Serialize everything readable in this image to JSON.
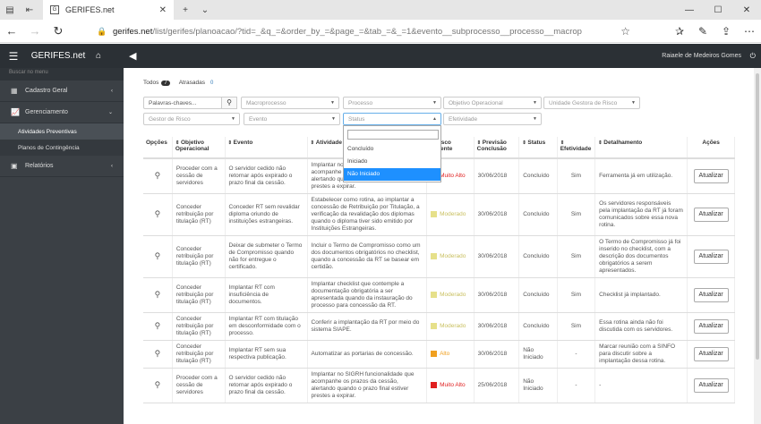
{
  "browser": {
    "tab_title": "GERIFES.net",
    "url_host": "gerifes.net",
    "url_path": "/list/gerifes/planoacao/?tid=_&q_=&order_by_=&page_=&tab_=&_=1&evento__subprocesso__processo__macrop"
  },
  "app": {
    "brand": "GERIFES.net",
    "user": "Raiaele de Medeiros Gomes"
  },
  "sidebar": {
    "search_placeholder": "Buscar no menu",
    "items": [
      {
        "label": "Cadastro Geral",
        "icon": "table-icon"
      },
      {
        "label": "Gerenciamento",
        "icon": "chart-icon"
      },
      {
        "label": "Relatórios",
        "icon": "report-icon"
      }
    ],
    "subitems": [
      "Atividades Preventivas",
      "Planos de Contingência"
    ]
  },
  "tabs": {
    "todos": "Todos",
    "todos_count": "7",
    "atrasadas": "Atrasadas",
    "atrasadas_count": "0"
  },
  "filters": {
    "keywords": "Palavras-chaves...",
    "macroprocesso": "Macroprocesso",
    "processo": "Processo",
    "objetivo": "Objetivo Operacional",
    "unidade": "Unidade Gestora de Risco",
    "gestor": "Gestor de Risco",
    "evento": "Evento",
    "status": "Status",
    "efetividade": "Efetividade"
  },
  "status_dropdown": {
    "options": [
      "Concluído",
      "Iniciado",
      "Não Iniciado"
    ],
    "selected": "Não Iniciado"
  },
  "table": {
    "headers": [
      "Opções",
      "Objetivo Operacional",
      "Evento",
      "Atividade",
      "Risco Inerente",
      "Previsão Conclusão",
      "Status",
      "Efetividade",
      "Detalhamento",
      "Ações"
    ],
    "action_label": "Atualizar",
    "rows": [
      {
        "obj": "Proceder com a cessão de servidores",
        "evento": "O servidor cedido não retornar após expirado o prazo final da cessão.",
        "atividade": "Implantar no SIGRH funcionalidade que acompanhe os prazos da cessão, alertando quando o prazo final estiver prestes a expirar.",
        "risco": "Muito Alto",
        "cor": "#e02020",
        "prev": "30/06/2018",
        "status": "Concluído",
        "efet": "Sim",
        "det": "Ferramenta já em utilização."
      },
      {
        "obj": "Conceder retribuição por titulação (RT)",
        "evento": "Conceder RT sem revalidar diploma oriundo de instituições estrangeiras.",
        "atividade": "Estabelecer como rotina, ao implantar a concessão de Retribuição por Titulação, a verificação da revalidação dos diplomas quando o diploma tiver sido emitido por Instituições Estrangeiras.",
        "risco": "Moderado",
        "cor": "#e6e08a",
        "prev": "30/06/2018",
        "status": "Concluído",
        "efet": "Sim",
        "det": "Os servidores responsáveis pela implantação da RT já foram comunicados sobre essa nova rotina."
      },
      {
        "obj": "Conceder retribuição por titulação (RT)",
        "evento": "Deixar de submeter o Termo de Compromisso quando não for entregue o certificado.",
        "atividade": "Incluir o Termo de Compromisso como um dos documentos obrigatórios no checklist, quando a concessão da RT se basear em certidão.",
        "risco": "Moderado",
        "cor": "#e6e08a",
        "prev": "30/06/2018",
        "status": "Concluído",
        "efet": "Sim",
        "det": "O Termo de Compromisso já foi inserido no checklist, com a descrição dos documentos obrigatórios a serem apresentados."
      },
      {
        "obj": "Conceder retribuição por titulação (RT)",
        "evento": "Implantar RT com insuficiência de documentos.",
        "atividade": "Implantar checklist que contemple a documentação obrigatória a ser apresentada quando da instauração do processo para concessão da RT.",
        "risco": "Moderado",
        "cor": "#e6e08a",
        "prev": "30/06/2018",
        "status": "Concluído",
        "efet": "Sim",
        "det": "Checklist já implantado."
      },
      {
        "obj": "Conceder retribuição por titulação (RT)",
        "evento": "Implantar RT com titulação em desconformidade com o processo.",
        "atividade": "Conferir a implantação da RT por meio do sistema SIAPE.",
        "risco": "Moderado",
        "cor": "#e6e08a",
        "prev": "30/06/2018",
        "status": "Concluído",
        "efet": "Sim",
        "det": "Essa rotina ainda não foi discutida com os servidores."
      },
      {
        "obj": "Conceder retribuição por titulação (RT)",
        "evento": "Implantar RT sem sua respectiva publicação.",
        "atividade": "Automatizar as portarias de concessão.",
        "risco": "Alto",
        "cor": "#f0a020",
        "prev": "30/06/2018",
        "status": "Não Iniciado",
        "efet": "-",
        "det": "Marcar reunião com a SINFO para discutir sobre a implantação dessa rotina."
      },
      {
        "obj": "Proceder com a cessão de servidores",
        "evento": "O servidor cedido não retornar após expirado o prazo final da cessão.",
        "atividade": "Implantar no SIGRH funcionalidade que acompanhe os prazos da cessão, alertando quando o prazo final estiver prestes a expirar.",
        "risco": "Muito Alto",
        "cor": "#e02020",
        "prev": "25/06/2018",
        "status": "Não Iniciado",
        "efet": "-",
        "det": "-"
      }
    ]
  }
}
